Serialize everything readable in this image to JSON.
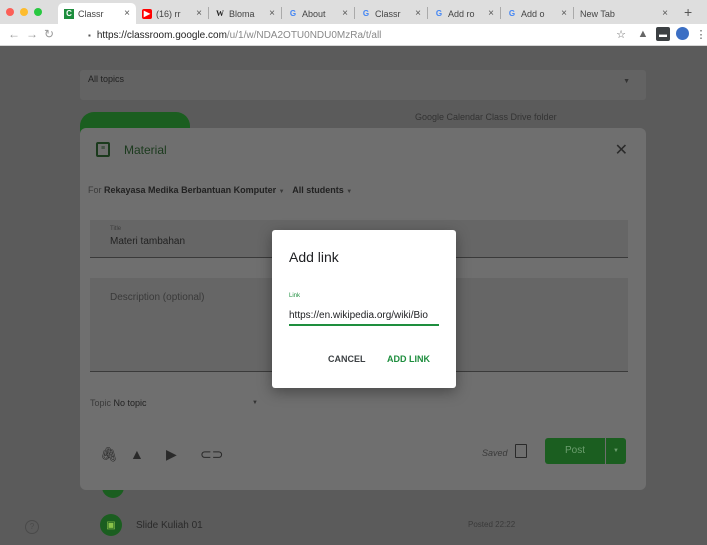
{
  "browser": {
    "tabs": [
      {
        "label": "Classr",
        "favicon": "C",
        "favicon_color": "#1e8e3e",
        "active": true
      },
      {
        "label": "(16) rr",
        "favicon": "▶",
        "favicon_color": "#ff0000",
        "active": false
      },
      {
        "label": "Bloma",
        "favicon": "W",
        "favicon_color": "#222222",
        "active": false
      },
      {
        "label": "About",
        "favicon": "G",
        "favicon_color": "#4285f4",
        "active": false
      },
      {
        "label": "Classr",
        "favicon": "G",
        "favicon_color": "#4285f4",
        "active": false
      },
      {
        "label": "Add ro",
        "favicon": "G",
        "favicon_color": "#4285f4",
        "active": false
      },
      {
        "label": "Add o",
        "favicon": "G",
        "favicon_color": "#4285f4",
        "active": false
      },
      {
        "label": "New Tab",
        "favicon": "",
        "favicon_color": "#777777",
        "active": false
      }
    ],
    "url_host": "https://classroom.google.com",
    "url_path": "/u/1/w/NDA2OTU0NDU0MzRa/t/all",
    "icons": [
      "back-icon",
      "forward-icon",
      "reload-icon",
      "lock-icon",
      "star-icon",
      "extension-icon",
      "extension-icon",
      "profile-icon",
      "menu-icon"
    ]
  },
  "background": {
    "topics_label": "All topics",
    "bg_links": "Google Calendar   Class Drive folder",
    "item_title": "Slide Kuliah 01",
    "item_time": "Posted 22:22",
    "help": "?"
  },
  "material_dialog": {
    "title": "Material",
    "for_prefix": "For",
    "class_name": "Rekayasa Medika Berbantuan Komputer",
    "audience": "All students",
    "title_field_label": "Title",
    "title_value": "Materi tambahan",
    "description_placeholder": "Description (optional)",
    "topic_prefix": "Topic",
    "topic_value": "No topic",
    "saved_label": "Saved",
    "post_label": "Post"
  },
  "add_link_dialog": {
    "title": "Add link",
    "field_label": "Link",
    "field_value": "https://en.wikipedia.org/wiki/Bio",
    "cancel_label": "CANCEL",
    "add_label": "ADD LINK"
  },
  "colors": {
    "accent_green": "#1e8e3e",
    "dark_green": "#1b5e20",
    "scrim": "#5f5f5f"
  }
}
